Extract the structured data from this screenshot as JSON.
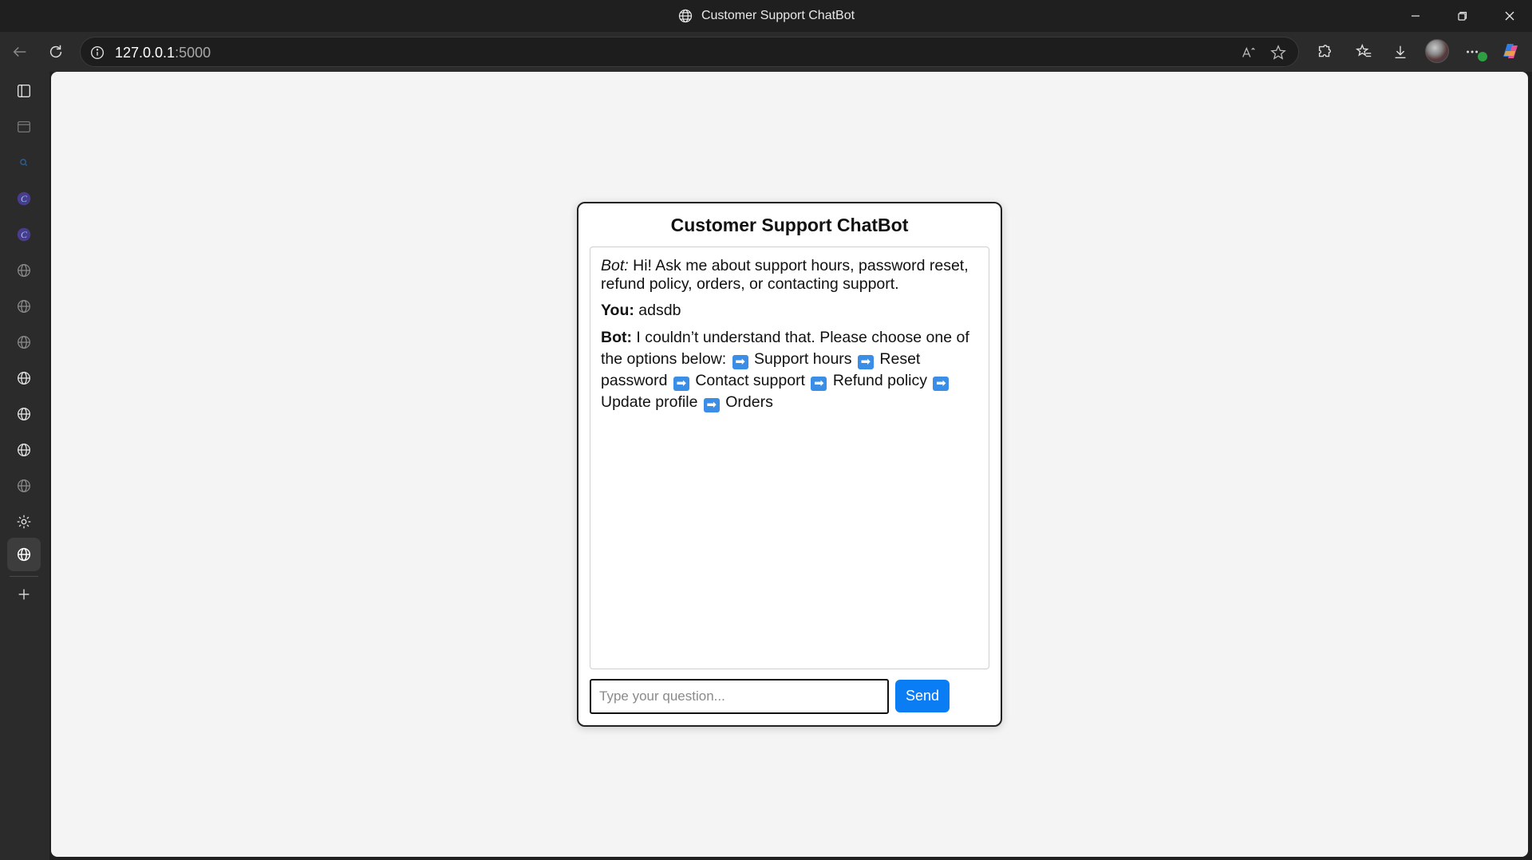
{
  "window": {
    "title": "Customer Support ChatBot"
  },
  "browser": {
    "url_host": "127.0.0.1",
    "url_port": ":5000"
  },
  "chat": {
    "heading": "Customer Support ChatBot",
    "messages": [
      {
        "sender": "Bot:",
        "text": " Hi! Ask me about support hours, password reset, refund policy, orders, or contacting support."
      },
      {
        "sender": "You:",
        "text": " adsdb"
      },
      {
        "sender": "Bot:",
        "text": " I couldn’t understand that. Please choose one of the options below:"
      }
    ],
    "options": [
      "Support hours",
      "Reset password",
      "Contact support",
      "Refund policy",
      "Update profile",
      "Orders"
    ],
    "option_marker": "➡",
    "input_placeholder": "Type your question...",
    "send_label": "Send"
  },
  "colors": {
    "send_button": "#0a7cf4",
    "arrow_badge": "#3a8ee6",
    "page_background": "#f4f4f4"
  }
}
